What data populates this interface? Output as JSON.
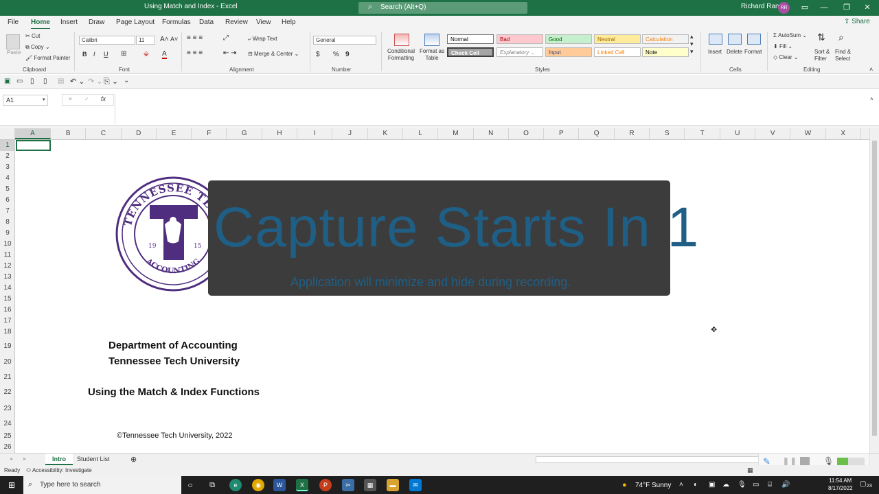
{
  "titlebar": {
    "doc_title": "Using Match and Index  -  Excel",
    "search_placeholder": "Search (Alt+Q)",
    "user_name": "Richard Rand",
    "user_initials": "RR"
  },
  "menu": {
    "tabs": [
      "File",
      "Home",
      "Insert",
      "Draw",
      "Page Layout",
      "Formulas",
      "Data",
      "Review",
      "View",
      "Help"
    ],
    "active": "Home",
    "share_label": "Share"
  },
  "ribbon": {
    "clipboard": {
      "paste": "Paste",
      "cut": "Cut",
      "copy": "Copy",
      "format_painter": "Format Painter",
      "group": "Clipboard"
    },
    "font": {
      "name": "Calibri",
      "size": "11",
      "group": "Font",
      "bold": "B",
      "italic": "I",
      "underline": "U"
    },
    "alignment": {
      "wrap": "Wrap Text",
      "merge": "Merge & Center",
      "group": "Alignment"
    },
    "number": {
      "format": "General",
      "group": "Number",
      "currency": "$",
      "percent": "%",
      "comma": "9"
    },
    "styles": {
      "conditional": "Conditional Formatting",
      "format_table": "Format as Table",
      "group": "Styles",
      "cells": [
        {
          "label": "Normal",
          "bg": "#ffffff",
          "fg": "#000000"
        },
        {
          "label": "Bad",
          "bg": "#ffc7ce",
          "fg": "#9c0006"
        },
        {
          "label": "Good",
          "bg": "#c6efce",
          "fg": "#006100"
        },
        {
          "label": "Neutral",
          "bg": "#ffeb9c",
          "fg": "#9c6500"
        },
        {
          "label": "Calculation",
          "bg": "#f2f2f2",
          "fg": "#fa7d00"
        },
        {
          "label": "Check Cell",
          "bg": "#a5a5a5",
          "fg": "#ffffff"
        },
        {
          "label": "Explanatory ...",
          "bg": "#ffffff",
          "fg": "#7f7f7f"
        },
        {
          "label": "Input",
          "bg": "#ffcc99",
          "fg": "#3f3f76"
        },
        {
          "label": "Linked Cell",
          "bg": "#ffffff",
          "fg": "#fa7d00"
        },
        {
          "label": "Note",
          "bg": "#ffffcc",
          "fg": "#000000"
        }
      ]
    },
    "cells": {
      "insert": "Insert",
      "delete": "Delete",
      "format": "Format",
      "group": "Cells"
    },
    "editing": {
      "autosum": "AutoSum",
      "fill": "Fill",
      "clear": "Clear",
      "sort": "Sort & Filter",
      "find": "Find & Select",
      "group": "Editing"
    }
  },
  "formula_bar": {
    "name_box": "A1",
    "fx": "fx",
    "value": ""
  },
  "columns": [
    "A",
    "B",
    "C",
    "D",
    "E",
    "F",
    "G",
    "H",
    "I",
    "J",
    "K",
    "L",
    "M",
    "N",
    "O",
    "P",
    "Q",
    "R",
    "S",
    "T",
    "U",
    "V",
    "W",
    "X"
  ],
  "rows": [
    "1",
    "2",
    "3",
    "4",
    "5",
    "6",
    "7",
    "8",
    "9",
    "10",
    "11",
    "12",
    "13",
    "14",
    "15",
    "16",
    "17",
    "18",
    "19",
    "20",
    "21",
    "22",
    "23",
    "24",
    "25",
    "26"
  ],
  "logo": {
    "top": "TENNESSEE TECH",
    "bottom": "ACCOUNTING",
    "year_left": "19",
    "year_right": "15",
    "letter": "T"
  },
  "sheet": {
    "dept": "Department of Accounting",
    "univ": "Tennessee Tech University",
    "topic": "Using the Match & Index Functions",
    "copyright": "©Tennessee Tech University, 2022"
  },
  "overlay": {
    "title": "Capture Starts In 1",
    "subtitle": "Application will minimize and hide during recording."
  },
  "sheet_tabs": [
    "Intro",
    "Student List"
  ],
  "active_sheet": "Intro",
  "status": {
    "ready": "Ready",
    "accessibility": "Accessibility: Investigate"
  },
  "taskbar": {
    "search_placeholder": "Type here to search",
    "weather": "74°F  Sunny",
    "time": "11:54 AM",
    "date": "8/17/2022",
    "notif_count": "23"
  }
}
